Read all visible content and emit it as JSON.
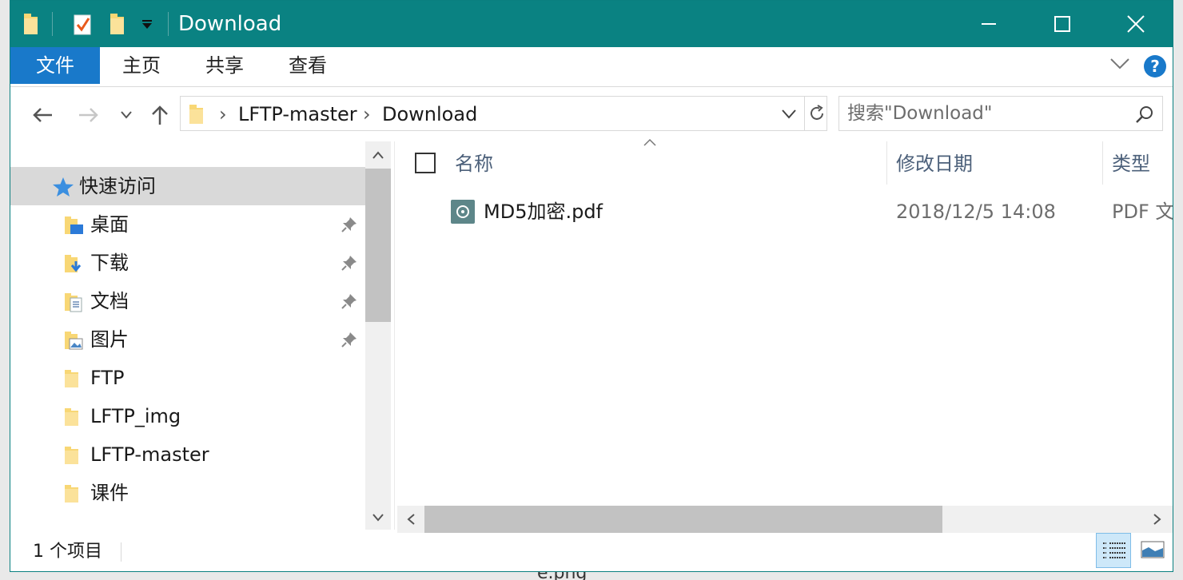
{
  "window": {
    "title": "Download",
    "accent": "#0a8282",
    "file_tab_color": "#1979ca"
  },
  "quick_access_toolbar": {
    "icons": [
      "folder-icon",
      "properties-icon",
      "new-folder-icon",
      "customize-dropdown-icon"
    ]
  },
  "window_controls": [
    "minimize",
    "maximize",
    "close"
  ],
  "ribbon": {
    "tabs": [
      "文件",
      "主页",
      "共享",
      "查看"
    ],
    "help_label": "?"
  },
  "address": {
    "breadcrumb": [
      "LFTP-master",
      "Download"
    ],
    "separator": "›"
  },
  "search": {
    "placeholder": "搜索\"Download\""
  },
  "nav_pane": {
    "quick_access_label": "快速访问",
    "items": [
      {
        "label": "桌面",
        "icon": "desktop-folder-icon",
        "pinned": true
      },
      {
        "label": "下载",
        "icon": "downloads-folder-icon",
        "pinned": true
      },
      {
        "label": "文档",
        "icon": "documents-folder-icon",
        "pinned": true
      },
      {
        "label": "图片",
        "icon": "pictures-folder-icon",
        "pinned": true
      },
      {
        "label": "FTP",
        "icon": "folder-icon",
        "pinned": false
      },
      {
        "label": "LFTP_img",
        "icon": "folder-icon",
        "pinned": false
      },
      {
        "label": "LFTP-master",
        "icon": "folder-icon",
        "pinned": false
      },
      {
        "label": "课件",
        "icon": "folder-icon",
        "pinned": false
      }
    ]
  },
  "file_list": {
    "columns": [
      "名称",
      "修改日期",
      "类型"
    ],
    "rows": [
      {
        "name": "MD5加密.pdf",
        "modified": "2018/12/5 14:08",
        "type": "PDF 文"
      }
    ]
  },
  "status": {
    "item_count": "1 个项目"
  },
  "background": {
    "partial_text": "e.png"
  }
}
